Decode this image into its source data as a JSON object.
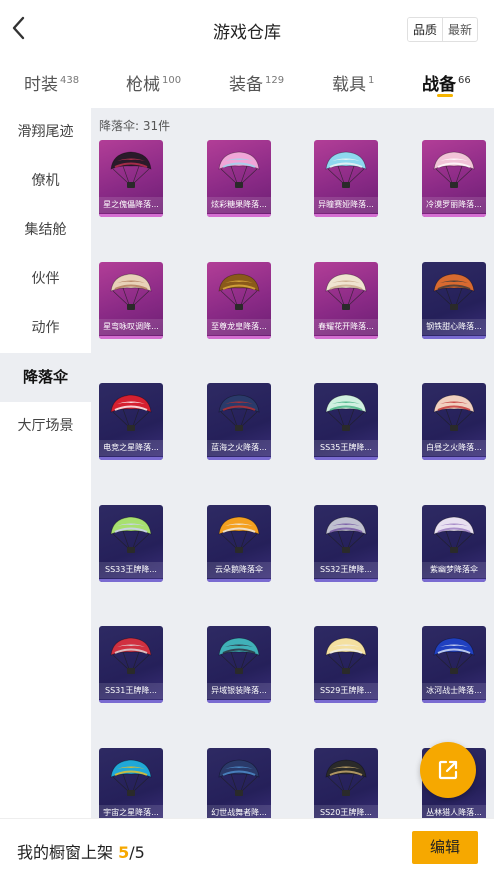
{
  "header": {
    "title": "游戏仓库",
    "sort_options": [
      "品质",
      "最新"
    ]
  },
  "tabs": [
    {
      "label": "时装",
      "count": "438"
    },
    {
      "label": "枪械",
      "count": "100"
    },
    {
      "label": "装备",
      "count": "129"
    },
    {
      "label": "载具",
      "count": "1"
    },
    {
      "label": "战备",
      "count": "66"
    }
  ],
  "sidebar": {
    "items": [
      "滑翔尾迹",
      "僚机",
      "集结舱",
      "伙伴",
      "动作",
      "降落伞",
      "大厅场景"
    ]
  },
  "content": {
    "count_label": "降落伞: 31件",
    "items": [
      {
        "name": "星之傀儡降落...",
        "style": "pink",
        "colors": [
          "#2a1a2a",
          "#c23050"
        ]
      },
      {
        "name": "炫彩糖果降落...",
        "style": "pink",
        "colors": [
          "#f0a6d8",
          "#9ad8f0"
        ]
      },
      {
        "name": "异瞳赛娅降落...",
        "style": "pink",
        "colors": [
          "#8ed8ef",
          "#f4f4f4"
        ]
      },
      {
        "name": "冷漠罗丽降落...",
        "style": "pink",
        "colors": [
          "#f2c4d8",
          "#ffffff"
        ]
      },
      {
        "name": "星弯咏叹调降...",
        "style": "pink",
        "colors": [
          "#e8d2b8",
          "#b07a5a"
        ]
      },
      {
        "name": "至尊龙皇降落...",
        "style": "pink",
        "colors": [
          "#8a5a1a",
          "#e0b040"
        ]
      },
      {
        "name": "春耀花开降落...",
        "style": "pink",
        "colors": [
          "#efe4d0",
          "#c8a888"
        ]
      },
      {
        "name": "钢铁甜心降落...",
        "style": "purple",
        "colors": [
          "#d86a30",
          "#3a3a3a"
        ]
      },
      {
        "name": "电竞之星降落...",
        "style": "purple",
        "colors": [
          "#d62030",
          "#ffffff"
        ]
      },
      {
        "name": "蓝海之火降落...",
        "style": "purple",
        "colors": [
          "#2a3a6a",
          "#c03030"
        ]
      },
      {
        "name": "SS35王牌降...",
        "style": "purple",
        "colors": [
          "#d0f0e0",
          "#40b080"
        ]
      },
      {
        "name": "白昼之火降落...",
        "style": "purple",
        "colors": [
          "#f0d0c0",
          "#c03030"
        ]
      },
      {
        "name": "SS33王牌降...",
        "style": "purple",
        "colors": [
          "#a8e070",
          "#d0d0ff"
        ]
      },
      {
        "name": "云朵鹅降落伞",
        "style": "purple",
        "colors": [
          "#f4a020",
          "#f0f0f0"
        ]
      },
      {
        "name": "SS32王牌降...",
        "style": "purple",
        "colors": [
          "#c0c0d0",
          "#7050a0"
        ]
      },
      {
        "name": "紫幽梦降落伞",
        "style": "purple",
        "colors": [
          "#e8e0f0",
          "#9a7ac0"
        ]
      },
      {
        "name": "SS31王牌降...",
        "style": "purple",
        "colors": [
          "#d03040",
          "#e0e0e0"
        ]
      },
      {
        "name": "异域银装降落...",
        "style": "purple",
        "colors": [
          "#40b0b8",
          "#2a2a3a"
        ]
      },
      {
        "name": "SS29王牌降...",
        "style": "purple",
        "colors": [
          "#f4e0a0",
          "#f0f0f0"
        ]
      },
      {
        "name": "冰河战士降落...",
        "style": "purple",
        "colors": [
          "#2040c0",
          "#e0e8f8"
        ]
      },
      {
        "name": "宇宙之星降落...",
        "style": "purple",
        "colors": [
          "#20a8d8",
          "#f0c020"
        ]
      },
      {
        "name": "幻世战舞者降...",
        "style": "purple",
        "colors": [
          "#2a3a6a",
          "#5090d0"
        ]
      },
      {
        "name": "SS20王牌降...",
        "style": "purple",
        "colors": [
          "#2a2a2a",
          "#d0b070"
        ]
      },
      {
        "name": "丛林猎人降落...",
        "style": "purple",
        "colors": [
          "#405a30",
          "#a09060"
        ]
      }
    ]
  },
  "footer": {
    "label": "我的橱窗上架",
    "current": "5",
    "total": "/5",
    "edit_label": "编辑"
  },
  "colors": {
    "accent": "#f6a800",
    "content_bg": "#eceef2"
  }
}
